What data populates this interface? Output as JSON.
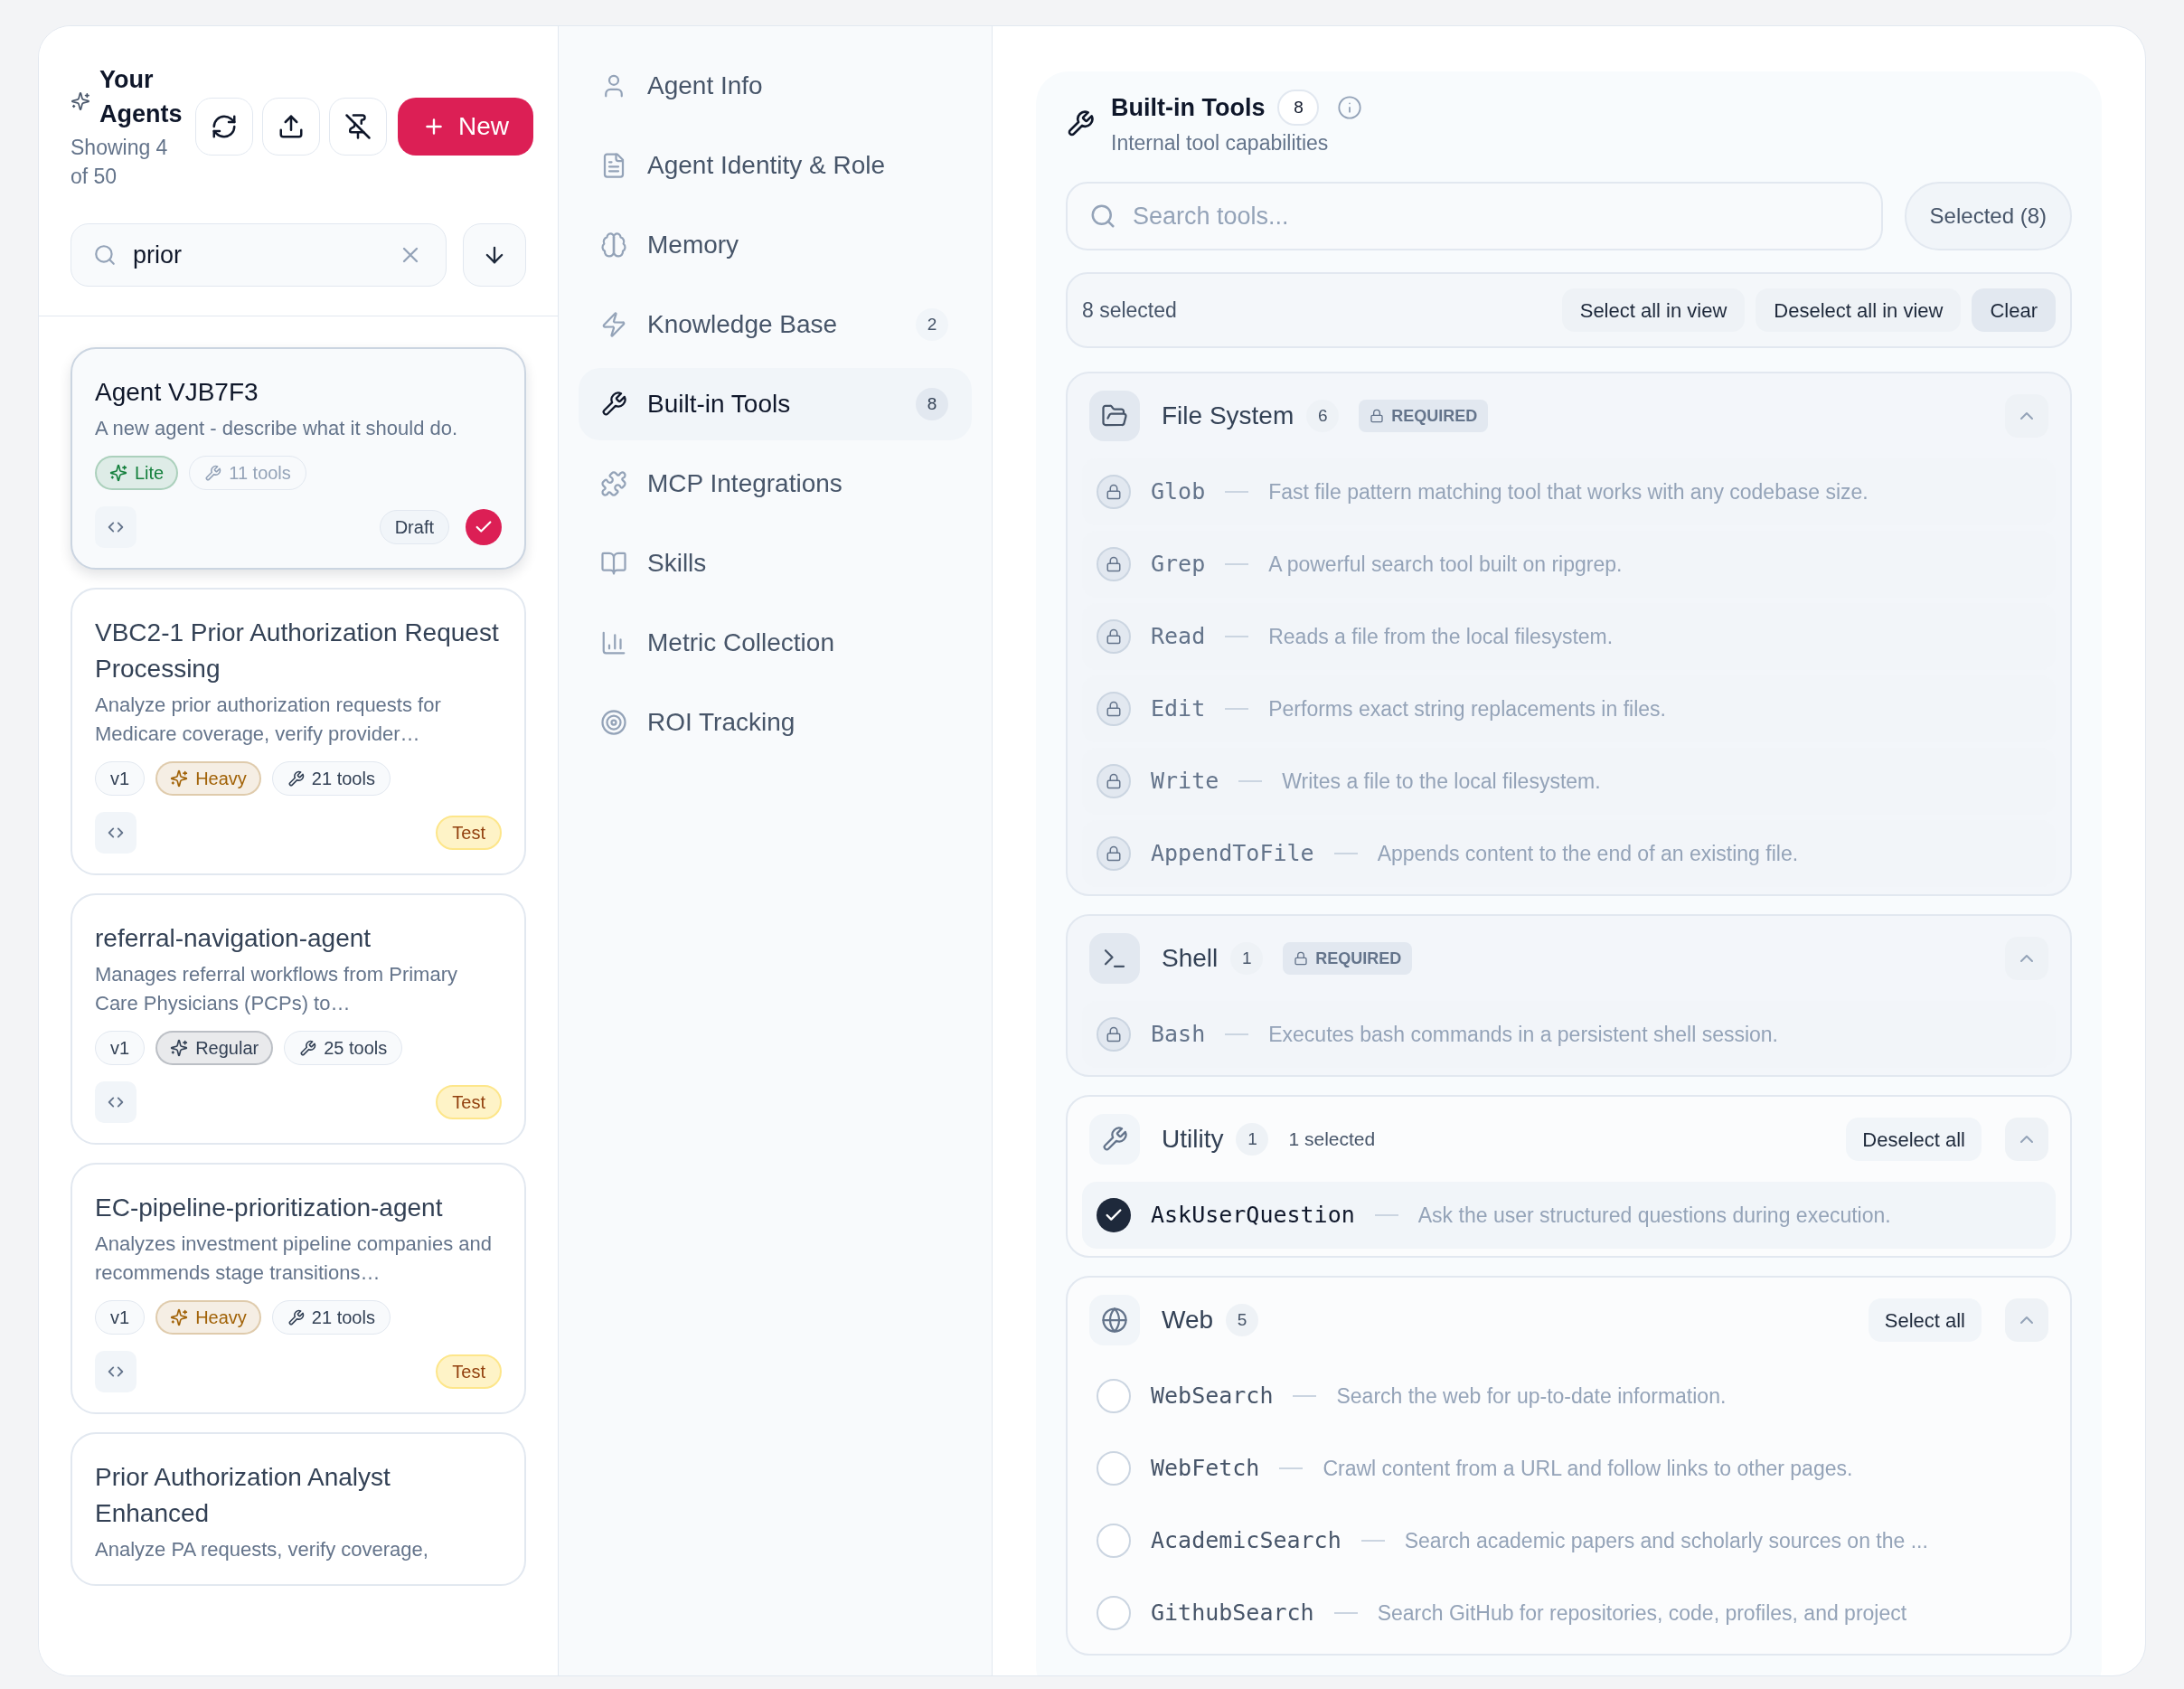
{
  "agents_panel": {
    "title": "Your Agents",
    "subtitle": "Showing 4 of 50",
    "new_button": "New",
    "search": {
      "value": "prior"
    }
  },
  "agents": [
    {
      "name": "Agent VJB7F3",
      "description": "A new agent - describe what it should do.",
      "badges": [
        {
          "kind": "tier",
          "label": "Lite",
          "color": "#15803d"
        },
        {
          "kind": "tools",
          "label": "11 tools"
        }
      ],
      "status": {
        "kind": "draft",
        "label": "Draft"
      },
      "selected": true
    },
    {
      "name": "VBC2-1 Prior Authorization Request Processing",
      "description": "Analyze prior authorization requests for Medicare coverage, verify provider…",
      "badges": [
        {
          "kind": "version",
          "label": "v1"
        },
        {
          "kind": "tier",
          "label": "Heavy",
          "color": "#a16207"
        },
        {
          "kind": "tools",
          "label": "21 tools"
        }
      ],
      "status": {
        "kind": "test",
        "label": "Test"
      },
      "selected": false
    },
    {
      "name": "referral-navigation-agent",
      "description": "Manages referral workflows from Primary Care Physicians (PCPs) to…",
      "badges": [
        {
          "kind": "version",
          "label": "v1"
        },
        {
          "kind": "tier",
          "label": "Regular",
          "color": "#334155"
        },
        {
          "kind": "tools",
          "label": "25 tools"
        }
      ],
      "status": {
        "kind": "test",
        "label": "Test"
      },
      "selected": false
    },
    {
      "name": "EC-pipeline-prioritization-agent",
      "description": "Analyzes investment pipeline companies and recommends stage transitions…",
      "badges": [
        {
          "kind": "version",
          "label": "v1"
        },
        {
          "kind": "tier",
          "label": "Heavy",
          "color": "#a16207"
        },
        {
          "kind": "tools",
          "label": "21 tools"
        }
      ],
      "status": {
        "kind": "test",
        "label": "Test"
      },
      "selected": false
    },
    {
      "name": "Prior Authorization Analyst Enhanced",
      "description": "Analyze PA requests, verify coverage,",
      "selected": false
    }
  ],
  "nav": [
    {
      "label": "Agent Info",
      "selected": false
    },
    {
      "label": "Agent Identity & Role",
      "selected": false
    },
    {
      "label": "Memory",
      "selected": false
    },
    {
      "label": "Knowledge Base",
      "count": "2",
      "selected": false
    },
    {
      "label": "Built-in Tools",
      "count": "8",
      "selected": true
    },
    {
      "label": "MCP Integrations",
      "selected": false
    },
    {
      "label": "Skills",
      "selected": false
    },
    {
      "label": "Metric Collection",
      "selected": false
    },
    {
      "label": "ROI Tracking",
      "selected": false
    }
  ],
  "tools_panel": {
    "title": "Built-in Tools",
    "count": "8",
    "subtitle": "Internal tool capabilities",
    "search": {
      "placeholder": "Search tools..."
    },
    "filter_button": "Selected (8)",
    "selection_summary": "8 selected",
    "bulk_actions": [
      "Select all in view",
      "Deselect all in view",
      "Clear"
    ]
  },
  "groups": [
    {
      "name": "File System",
      "count": "6",
      "required_label": "REQUIRED",
      "expanded": true,
      "tools": [
        {
          "kind": "locked",
          "name": "Glob",
          "description": "Fast file pattern matching tool that works with any codebase size."
        },
        {
          "kind": "locked",
          "name": "Grep",
          "description": "A powerful search tool built on ripgrep."
        },
        {
          "kind": "locked",
          "name": "Read",
          "description": "Reads a file from the local filesystem."
        },
        {
          "kind": "locked",
          "name": "Edit",
          "description": "Performs exact string replacements in files."
        },
        {
          "kind": "locked",
          "name": "Write",
          "description": "Writes a file to the local filesystem."
        },
        {
          "kind": "locked",
          "name": "AppendToFile",
          "description": "Appends content to the end of an existing file."
        }
      ]
    },
    {
      "name": "Shell",
      "count": "1",
      "required_label": "REQUIRED",
      "expanded": true,
      "tools": [
        {
          "kind": "locked",
          "name": "Bash",
          "description": "Executes bash commands in a persistent shell session."
        }
      ]
    },
    {
      "name": "Utility",
      "count": "1",
      "selected_note": "1 selected",
      "action": "Deselect all",
      "expanded": true,
      "tools": [
        {
          "kind": "checkbox",
          "name": "AskUserQuestion",
          "description": "Ask the user structured questions during execution.",
          "checked": true
        }
      ]
    },
    {
      "name": "Web",
      "count": "5",
      "action": "Select all",
      "expanded": true,
      "tools": [
        {
          "kind": "checkbox",
          "name": "WebSearch",
          "description": "Search the web for up-to-date information.",
          "checked": false
        },
        {
          "kind": "checkbox",
          "name": "WebFetch",
          "description": "Crawl content from a URL and follow links to other pages.",
          "checked": false
        },
        {
          "kind": "checkbox",
          "name": "AcademicSearch",
          "description": "Search academic papers and scholarly sources on the ...",
          "checked": false
        },
        {
          "kind": "checkbox",
          "name": "GithubSearch",
          "description": "Search GitHub for repositories, code, profiles, and project",
          "checked": false
        }
      ]
    }
  ]
}
